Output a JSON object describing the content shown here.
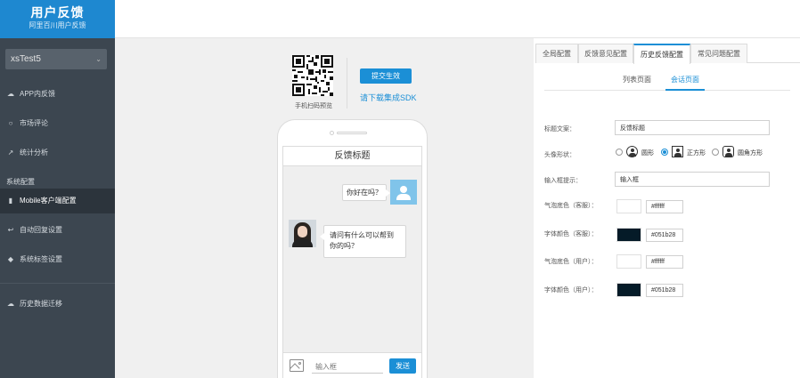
{
  "brand": {
    "title": "用户反馈",
    "subtitle": "阿里百川用户反馈"
  },
  "app_select": {
    "value": "xsTest5"
  },
  "sidebar": {
    "section_label": "系统配置",
    "items": [
      {
        "label": "APP内反馈",
        "icon": "cloud-icon"
      },
      {
        "label": "市场评论",
        "icon": "comment-icon"
      },
      {
        "label": "统计分析",
        "icon": "chart-icon"
      },
      {
        "label": "Mobile客户端配置",
        "icon": "mobile-icon"
      },
      {
        "label": "自动回复设置",
        "icon": "reply-icon"
      },
      {
        "label": "系统标签设置",
        "icon": "tag-icon"
      },
      {
        "label": "历史数据迁移",
        "icon": "cloud-upload-icon"
      }
    ]
  },
  "preview": {
    "qr_caption": "手机扫码预览",
    "submit_label": "提交生效",
    "sdk_link": "请下载集成SDK",
    "phone_title": "反馈标题",
    "user_message": "你好在吗？",
    "agent_message": "请问有什么可以帮到你的吗？",
    "input_placeholder": "输入框",
    "send_label": "发送"
  },
  "tabs": [
    {
      "label": "全局配置",
      "active": false
    },
    {
      "label": "反馈意见配置",
      "active": false
    },
    {
      "label": "历史反馈配置",
      "active": true
    },
    {
      "label": "常见问题配置",
      "active": false
    }
  ],
  "subtabs": [
    {
      "label": "列表页面",
      "active": false
    },
    {
      "label": "会话页面",
      "active": true
    }
  ],
  "form": {
    "title_label": "标题文案：",
    "title_value": "反馈标题",
    "avatar_label": "头像形状：",
    "avatar_options": [
      {
        "label": "圆形",
        "checked": false
      },
      {
        "label": "正方形",
        "checked": true
      },
      {
        "label": "圆角方形",
        "checked": false
      }
    ],
    "input_hint_label": "输入框提示：",
    "input_hint_value": "输入框",
    "bubble_agent_label": "气泡底色（客服）：",
    "bubble_agent_color": "#ffffff",
    "font_agent_label": "字体颜色（客服）：",
    "font_agent_color": "#051b28",
    "bubble_user_label": "气泡底色（用户）：",
    "bubble_user_color": "#ffffff",
    "font_user_label": "字体颜色（用户）：",
    "font_user_color": "#051b28"
  },
  "colors": {
    "accent": "#1b8fd6",
    "sidebar": "#3c4650",
    "brand": "#1e88d0"
  }
}
